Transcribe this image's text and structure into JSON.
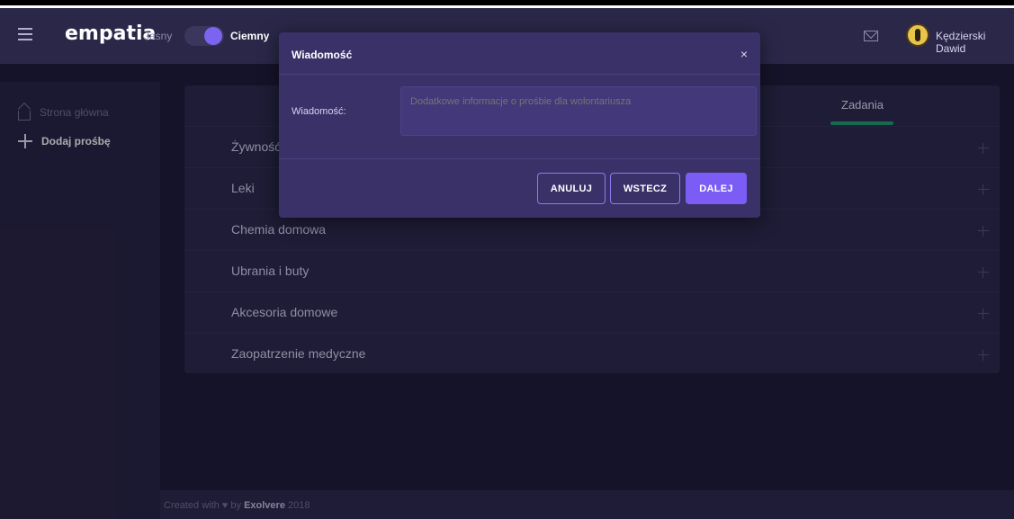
{
  "header": {
    "brand": "empatia",
    "theme_light_label": "Jasny",
    "theme_dark_label": "Ciemny",
    "user_name": "Kędzierski Dawid"
  },
  "sidebar": {
    "items": [
      {
        "label": "Strona główna",
        "icon": "home-icon"
      },
      {
        "label": "Dodaj prośbę",
        "icon": "plus-icon"
      }
    ]
  },
  "main": {
    "tab_label": "Zadania",
    "categories": [
      "Żywność",
      "Leki",
      "Chemia domowa",
      "Ubrania i buty",
      "Akcesoria domowe",
      "Zaopatrzenie medyczne"
    ]
  },
  "modal": {
    "title": "Wiadomość",
    "close_symbol": "×",
    "field_label": "Wiadomość:",
    "field_placeholder": "Dodatkowe informacje o prośbie dla wolontariusza",
    "btn_cancel": "ANULUJ",
    "btn_back": "WSTECZ",
    "btn_next": "DALEJ"
  },
  "footer": {
    "prefix": "Created with ♥ by",
    "company": "Exolvere",
    "year": "2018"
  },
  "colors": {
    "accent": "#7b5df5",
    "tab_underline": "#1e9e6a",
    "background": "#1c1a33",
    "modal_bg": "#3b3169"
  }
}
